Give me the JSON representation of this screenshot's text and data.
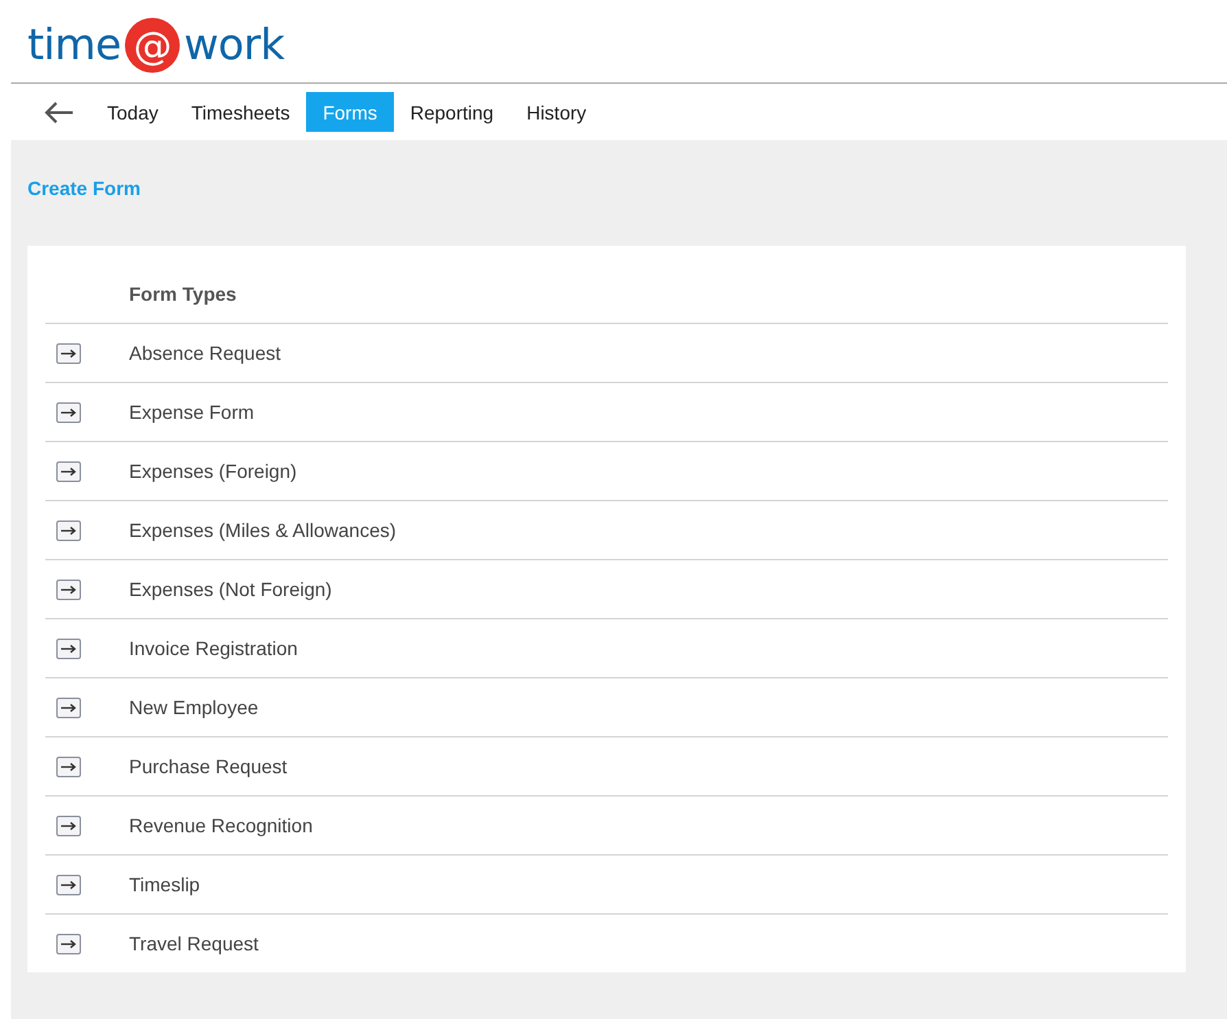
{
  "logo": {
    "left": "time",
    "at": "@",
    "right": "work"
  },
  "nav": [
    {
      "label": "Today",
      "selected": false
    },
    {
      "label": "Timesheets",
      "selected": false
    },
    {
      "label": "Forms",
      "selected": true
    },
    {
      "label": "Reporting",
      "selected": false
    },
    {
      "label": "History",
      "selected": false
    }
  ],
  "create_link": "Create Form",
  "table": {
    "header": "Form Types",
    "rows": [
      "Absence Request",
      "Expense Form",
      "Expenses (Foreign)",
      "Expenses (Miles & Allowances)",
      "Expenses (Not Foreign)",
      "Invoice Registration",
      "New Employee",
      "Purchase Request",
      "Revenue Recognition",
      "Timeslip",
      "Travel Request"
    ]
  }
}
